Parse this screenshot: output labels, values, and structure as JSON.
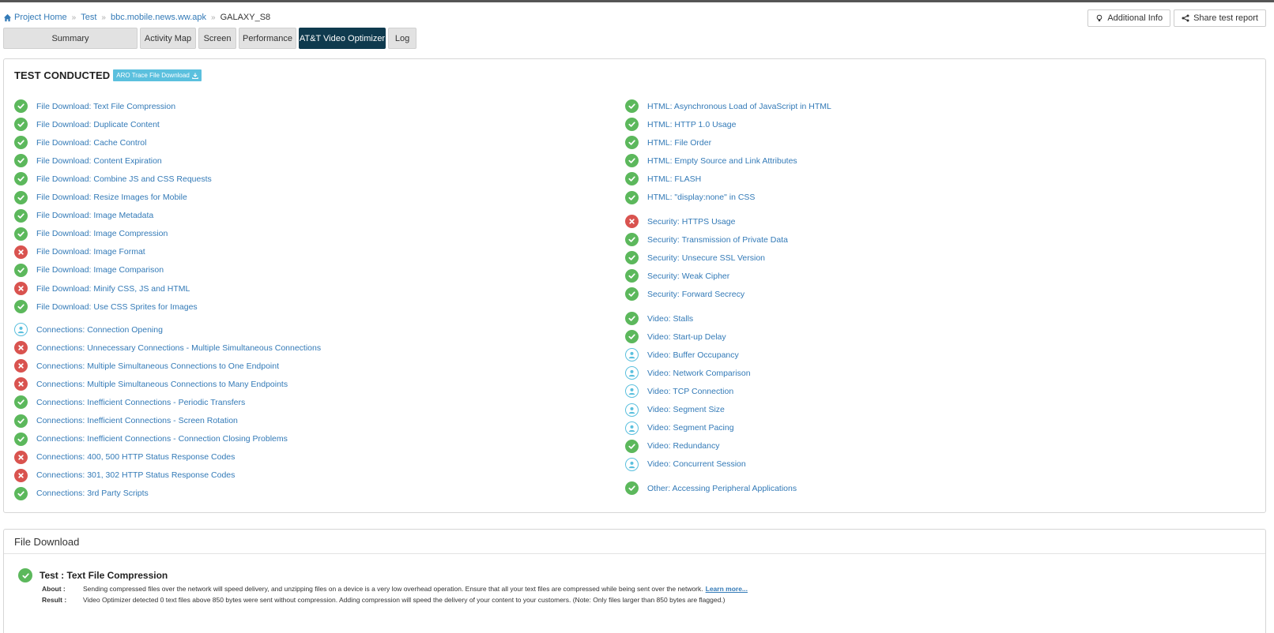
{
  "breadcrumb": {
    "items": [
      "Project Home",
      "Test",
      "bbc.mobile.news.ww.apk"
    ],
    "current": "GALAXY_S8",
    "separator": "»"
  },
  "top_buttons": {
    "additional_info": "Additional Info",
    "share": "Share test report"
  },
  "tabs": [
    "Summary",
    "Activity Map",
    "Screen",
    "Performance",
    "AT&T Video Optimizer",
    "Log"
  ],
  "active_tab": "AT&T Video Optimizer",
  "test_conducted": {
    "title": "TEST CONDUCTED",
    "download_label": "ARO Trace File Download",
    "left_tests": [
      {
        "label": "File Download: Text File Compression",
        "status": "pass"
      },
      {
        "label": "File Download: Duplicate Content",
        "status": "pass"
      },
      {
        "label": "File Download: Cache Control",
        "status": "pass"
      },
      {
        "label": "File Download: Content Expiration",
        "status": "pass"
      },
      {
        "label": "File Download: Combine JS and CSS Requests",
        "status": "pass"
      },
      {
        "label": "File Download: Resize Images for Mobile",
        "status": "pass"
      },
      {
        "label": "File Download: Image Metadata",
        "status": "pass"
      },
      {
        "label": "File Download: Image Compression",
        "status": "pass"
      },
      {
        "label": "File Download: Image Format",
        "status": "fail"
      },
      {
        "label": "File Download: Image Comparison",
        "status": "pass"
      },
      {
        "label": "File Download: Minify CSS, JS and HTML",
        "status": "fail"
      },
      {
        "label": "File Download: Use CSS Sprites for Images",
        "status": "pass"
      },
      {
        "label": "Connections: Connection Opening",
        "status": "info"
      },
      {
        "label": "Connections: Unnecessary Connections - Multiple Simultaneous Connections",
        "status": "fail"
      },
      {
        "label": "Connections: Multiple Simultaneous Connections to One Endpoint",
        "status": "fail"
      },
      {
        "label": "Connections: Multiple Simultaneous Connections to Many Endpoints",
        "status": "fail"
      },
      {
        "label": "Connections: Inefficient Connections - Periodic Transfers",
        "status": "pass"
      },
      {
        "label": "Connections: Inefficient Connections - Screen Rotation",
        "status": "pass"
      },
      {
        "label": "Connections: Inefficient Connections - Connection Closing Problems",
        "status": "pass"
      },
      {
        "label": "Connections: 400, 500 HTTP Status Response Codes",
        "status": "fail"
      },
      {
        "label": "Connections: 301, 302 HTTP Status Response Codes",
        "status": "fail"
      },
      {
        "label": "Connections: 3rd Party Scripts",
        "status": "pass"
      }
    ],
    "right_tests": [
      {
        "label": "HTML: Asynchronous Load of JavaScript in HTML",
        "status": "pass"
      },
      {
        "label": "HTML: HTTP 1.0 Usage",
        "status": "pass"
      },
      {
        "label": "HTML: File Order",
        "status": "pass"
      },
      {
        "label": "HTML: Empty Source and Link Attributes",
        "status": "pass"
      },
      {
        "label": "HTML: FLASH",
        "status": "pass"
      },
      {
        "label": "HTML: \"display:none\" in CSS",
        "status": "pass"
      },
      {
        "label": "Security: HTTPS Usage",
        "status": "fail"
      },
      {
        "label": "Security: Transmission of Private Data",
        "status": "pass"
      },
      {
        "label": "Security: Unsecure SSL Version",
        "status": "pass"
      },
      {
        "label": "Security: Weak Cipher",
        "status": "pass"
      },
      {
        "label": "Security: Forward Secrecy",
        "status": "pass"
      },
      {
        "label": "Video: Stalls",
        "status": "pass"
      },
      {
        "label": "Video: Start-up Delay",
        "status": "pass"
      },
      {
        "label": "Video: Buffer Occupancy",
        "status": "info"
      },
      {
        "label": "Video: Network Comparison",
        "status": "info"
      },
      {
        "label": "Video: TCP Connection",
        "status": "info"
      },
      {
        "label": "Video: Segment Size",
        "status": "info"
      },
      {
        "label": "Video: Segment Pacing",
        "status": "info"
      },
      {
        "label": "Video: Redundancy",
        "status": "pass"
      },
      {
        "label": "Video: Concurrent Session",
        "status": "info"
      },
      {
        "label": "Other: Accessing Peripheral Applications",
        "status": "pass"
      }
    ]
  },
  "file_download": {
    "header": "File Download",
    "test_title": "Test : Text File Compression",
    "about_label": "About :",
    "about_text": "Sending compressed files over the network will speed delivery, and unzipping files on a device is a very low overhead operation. Ensure that all your text files are compressed while being sent over the network.",
    "learn_more": "Learn more...",
    "result_label": "Result :",
    "result_text": "Video Optimizer detected 0 text files above 850 bytes were sent without compression. Adding compression will speed the delivery of your content to your customers. (Note: Only files larger than 850 bytes are flagged.)"
  },
  "colors": {
    "pass": "#5cb85c",
    "fail": "#d9534f",
    "info": "#5bc0de",
    "active_tab": "#0f3a4e",
    "link": "#337ab7"
  }
}
